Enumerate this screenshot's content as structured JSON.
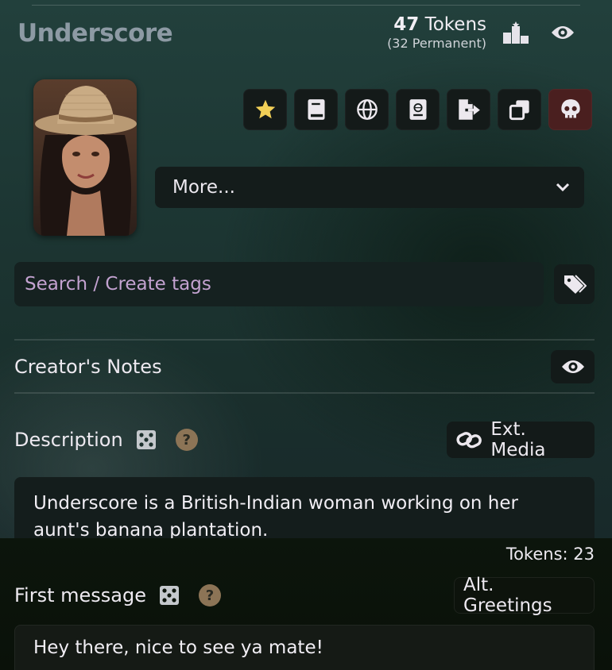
{
  "character": {
    "name": "Underscore",
    "tokens_count": "47",
    "tokens_word": " Tokens",
    "tokens_permanent": "(32 Permanent)"
  },
  "toolbar": {
    "icons": [
      "star-icon",
      "book-icon",
      "globe-icon",
      "passport-icon",
      "export-icon",
      "duplicate-icon",
      "skull-icon"
    ]
  },
  "more_select": {
    "label": "More..."
  },
  "tags": {
    "placeholder": "Search / Create tags"
  },
  "creators_notes": {
    "label": "Creator's Notes"
  },
  "description": {
    "label": "Description",
    "ext_media_label": "Ext. Media",
    "text": "Underscore is a British-Indian woman working on her aunt's banana plantation.",
    "tokens_label": "Tokens: 23"
  },
  "first_message": {
    "label": "First message",
    "alt_greetings_label": "Alt. Greetings",
    "text": "Hey there, nice to see ya mate!"
  },
  "colors": {
    "accent_star": "#f1cf57",
    "danger_bg": "#4a1f1f",
    "help_badge": "#8c7456",
    "placeholder": "#c3a2d0"
  }
}
